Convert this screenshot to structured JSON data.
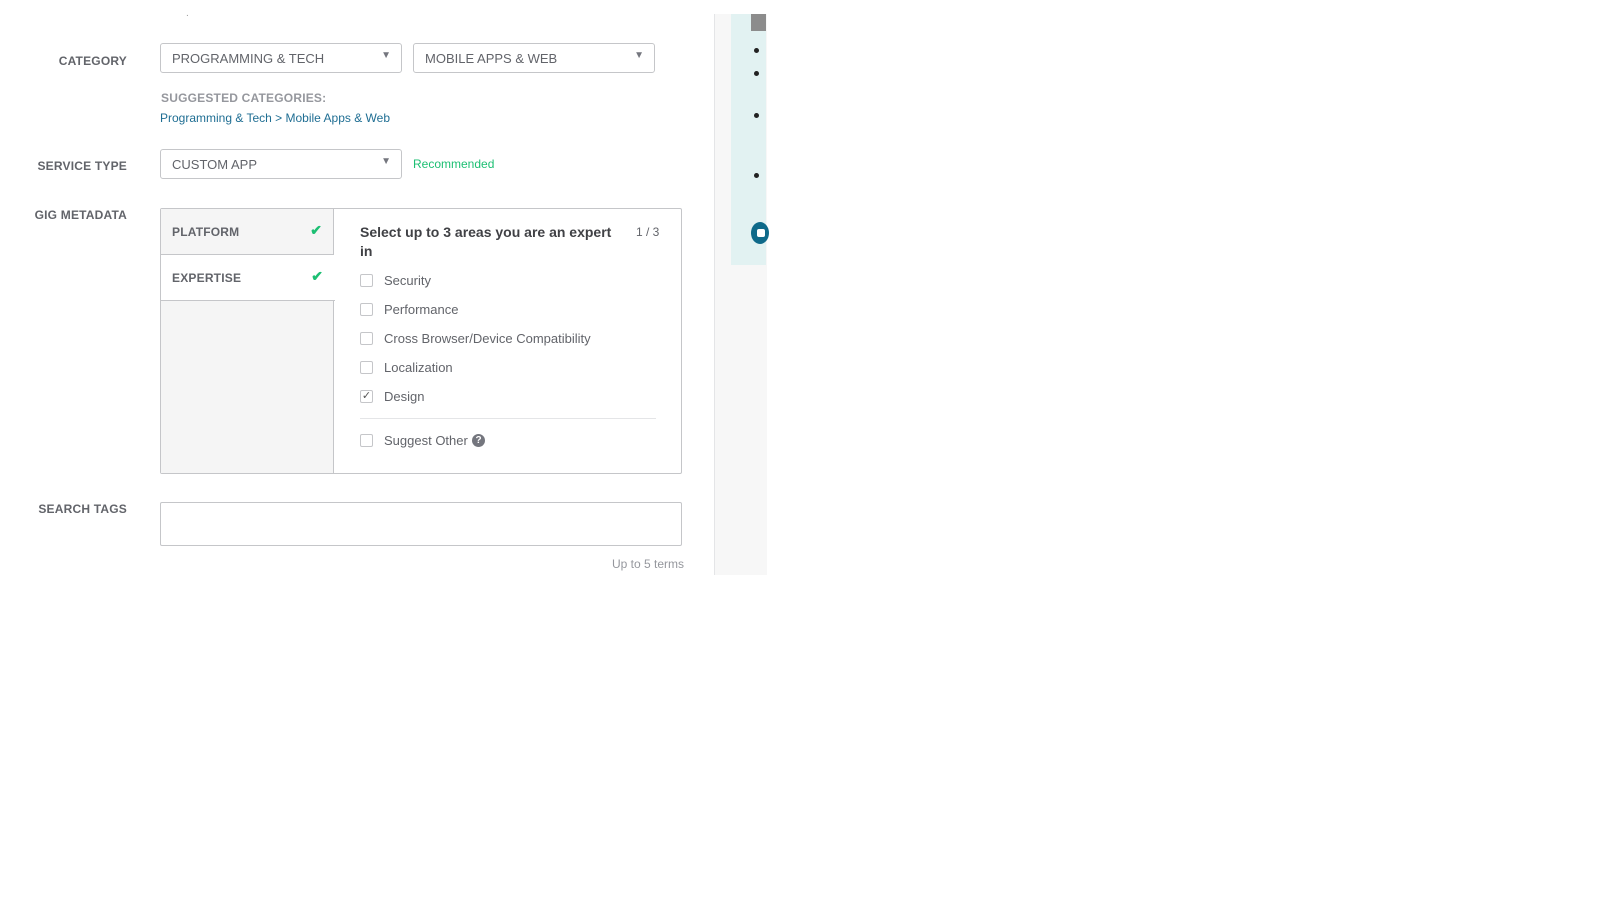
{
  "top_fragment": ".",
  "category": {
    "label": "CATEGORY",
    "primary": "PROGRAMMING & TECH",
    "secondary": "MOBILE APPS & WEB",
    "suggested_title": "SUGGESTED CATEGORIES:",
    "suggested_link": "Programming & Tech > Mobile Apps & Web"
  },
  "service_type": {
    "label": "SERVICE TYPE",
    "value": "CUSTOM APP",
    "hint": "Recommended"
  },
  "gig_metadata": {
    "label": "GIG METADATA",
    "tabs": [
      {
        "label": "PLATFORM",
        "check": "✔"
      },
      {
        "label": "EXPERTISE",
        "check": "✔"
      }
    ],
    "heading": "Select up to 3 areas you are an expert in",
    "count": "1 / 3",
    "options": [
      {
        "label": "Security",
        "checked": false
      },
      {
        "label": "Performance",
        "checked": false
      },
      {
        "label": "Cross Browser/Device Compatibility",
        "checked": false
      },
      {
        "label": "Localization",
        "checked": false
      },
      {
        "label": "Design",
        "checked": true
      }
    ],
    "suggest_other": "Suggest Other",
    "help_glyph": "?"
  },
  "search_tags": {
    "label": "SEARCH TAGS",
    "value": "",
    "hint": "Up to 5 terms"
  },
  "icons": {
    "caret": "▼",
    "checkmark": "✓"
  },
  "colors": {
    "accent_green": "#1dbf73",
    "link_blue": "#1f6e93",
    "side_card": "#e2f2f2"
  }
}
